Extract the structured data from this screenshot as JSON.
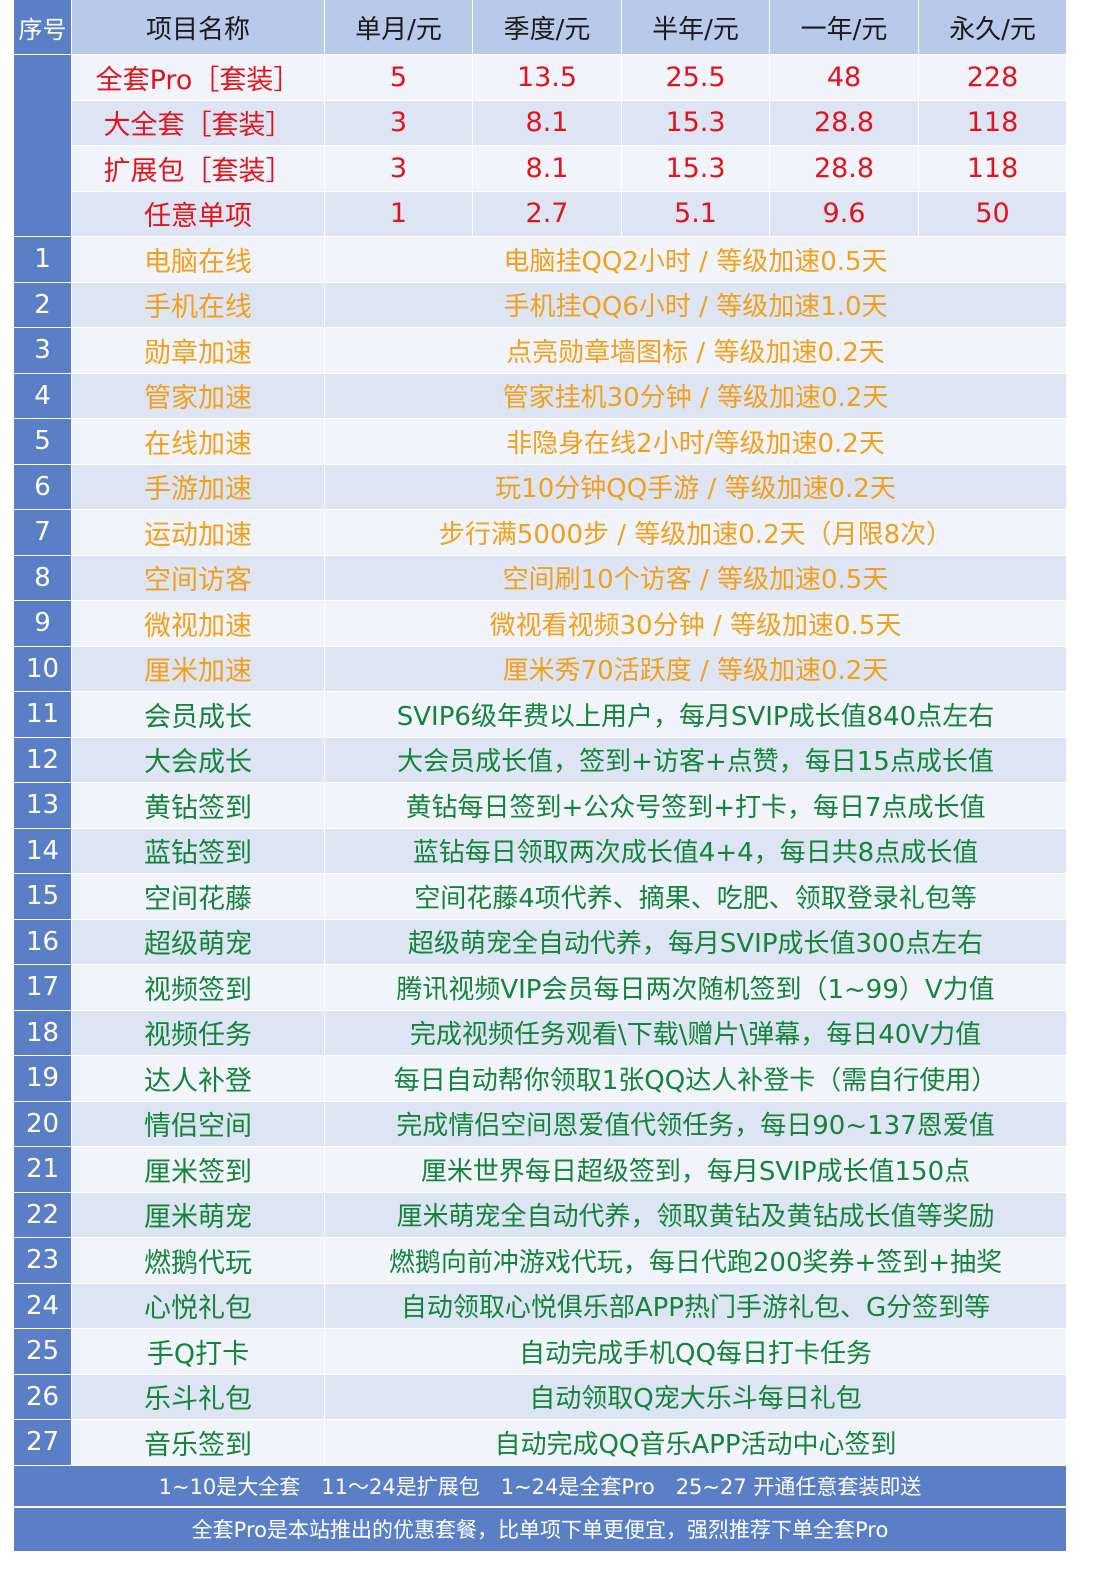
{
  "header": [
    "序号",
    "项目名称",
    "单月/元",
    "季度/元",
    "半年/元",
    "一年/元",
    "永久/元"
  ],
  "packages": [
    {
      "name": "全套Pro［套装］",
      "prices": [
        "5",
        "13.5",
        "25.5",
        "48",
        "228"
      ]
    },
    {
      "name": "大全套［套装］",
      "prices": [
        "3",
        "8.1",
        "15.3",
        "28.8",
        "118"
      ]
    },
    {
      "name": "扩展包［套装］",
      "prices": [
        "3",
        "8.1",
        "15.3",
        "28.8",
        "118"
      ]
    },
    {
      "name": "任意单项",
      "prices": [
        "1",
        "2.7",
        "5.1",
        "9.6",
        "50"
      ]
    }
  ],
  "items": [
    {
      "no": "1",
      "name": "电脑在线",
      "desc": "电脑挂QQ2小时 / 等级加速0.5天"
    },
    {
      "no": "2",
      "name": "手机在线",
      "desc": "手机挂QQ6小时 / 等级加速1.0天"
    },
    {
      "no": "3",
      "name": "勋章加速",
      "desc": "点亮勋章墙图标 / 等级加速0.2天"
    },
    {
      "no": "4",
      "name": "管家加速",
      "desc": "管家挂机30分钟 / 等级加速0.2天"
    },
    {
      "no": "5",
      "name": "在线加速",
      "desc": "非隐身在线2小时/等级加速0.2天"
    },
    {
      "no": "6",
      "name": "手游加速",
      "desc": "玩10分钟QQ手游 / 等级加速0.2天"
    },
    {
      "no": "7",
      "name": "运动加速",
      "desc": "步行满5000步 / 等级加速0.2天（月限8次）"
    },
    {
      "no": "8",
      "name": "空间访客",
      "desc": "空间刷10个访客 / 等级加速0.5天"
    },
    {
      "no": "9",
      "name": "微视加速",
      "desc": "微视看视频30分钟 / 等级加速0.5天"
    },
    {
      "no": "10",
      "name": "厘米加速",
      "desc": "厘米秀70活跃度 / 等级加速0.2天"
    },
    {
      "no": "11",
      "name": "会员成长",
      "desc": "SVIP6级年费以上用户，每月SVIP成长值840点左右"
    },
    {
      "no": "12",
      "name": "大会成长",
      "desc": "大会员成长值，签到+访客+点赞，每日15点成长值"
    },
    {
      "no": "13",
      "name": "黄钻签到",
      "desc": "黄钻每日签到+公众号签到+打卡，每日7点成长值"
    },
    {
      "no": "14",
      "name": "蓝钻签到",
      "desc": "蓝钻每日领取两次成长值4+4，每日共8点成长值"
    },
    {
      "no": "15",
      "name": "空间花藤",
      "desc": "空间花藤4项代养、摘果、吃肥、领取登录礼包等"
    },
    {
      "no": "16",
      "name": "超级萌宠",
      "desc": "超级萌宠全自动代养，每月SVIP成长值300点左右"
    },
    {
      "no": "17",
      "name": "视频签到",
      "desc": "腾讯视频VIP会员每日两次随机签到（1~99）V力值"
    },
    {
      "no": "18",
      "name": "视频任务",
      "desc": "完成视频任务观看\\下载\\赠片\\弹幕，每日40V力值"
    },
    {
      "no": "19",
      "name": "达人补登",
      "desc": "每日自动帮你领取1张QQ达人补登卡（需自行使用）"
    },
    {
      "no": "20",
      "name": "情侣空间",
      "desc": "完成情侣空间恩爱值代领任务，每日90~137恩爱值"
    },
    {
      "no": "21",
      "name": "厘米签到",
      "desc": "厘米世界每日超级签到，每月SVIP成长值150点"
    },
    {
      "no": "22",
      "name": "厘米萌宠",
      "desc": "厘米萌宠全自动代养，领取黄钻及黄钻成长值等奖励"
    },
    {
      "no": "23",
      "name": "燃鹅代玩",
      "desc": "燃鹅向前冲游戏代玩，每日代跑200奖券+签到+抽奖"
    },
    {
      "no": "24",
      "name": "心悦礼包",
      "desc": "自动领取心悦俱乐部APP热门手游礼包、G分签到等"
    },
    {
      "no": "25",
      "name": "手Q打卡",
      "desc": "自动完成手机QQ每日打卡任务"
    },
    {
      "no": "26",
      "name": "乐斗礼包",
      "desc": "自动领取Q宠大乐斗每日礼包"
    },
    {
      "no": "27",
      "name": "音乐签到",
      "desc": "自动完成QQ音乐APP活动中心签到"
    }
  ],
  "footer": {
    "line1": "1~10是大全套　11～24是扩展包　1~24是全套Pro　25~27 开通任意套装即送",
    "line2": "全套Pro是本站推出的优惠套餐，比单项下单更便宜，强烈推荐下单全套Pro"
  },
  "colors": {
    "header_bg": "#b9c9ea",
    "number_col": "#5b7fc6",
    "package_text": "#e1141b",
    "group1_text": "#f2a019",
    "group2_text": "#13843a"
  }
}
